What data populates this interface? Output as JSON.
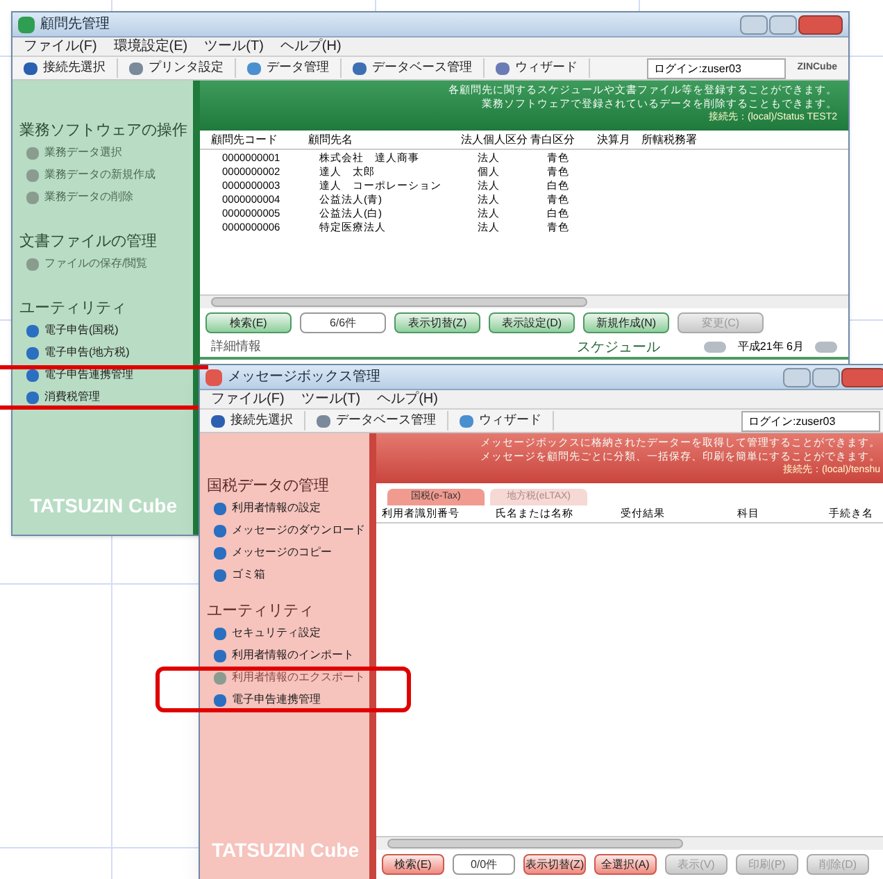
{
  "back_window": {
    "title": "顧問先管理",
    "menu": [
      "ファイル(F)",
      "環境設定(E)",
      "ツール(T)",
      "ヘルプ(H)"
    ],
    "toolbar": [
      "接続先選択",
      "プリンタ設定",
      "データ管理",
      "データベース管理",
      "ウィザード"
    ],
    "login": "ログイン:zuser03",
    "logo_small": "ZINCube",
    "banner": [
      "各顧問先に関するスケジュールや文書ファイル等を登録することができます。",
      "業務ソフトウェアで登録されているデータを削除することもできます。"
    ],
    "connection": "接続先：(local)/Status TEST2",
    "sidebar": [
      {
        "heading": "業務ソフトウェアの操作",
        "items": [
          {
            "label": "業務データ選択",
            "disabled": true
          },
          {
            "label": "業務データの新規作成",
            "disabled": true
          },
          {
            "label": "業務データの削除",
            "disabled": true
          }
        ]
      },
      {
        "heading": "文書ファイルの管理",
        "items": [
          {
            "label": "ファイルの保存/閲覧",
            "disabled": true
          }
        ]
      },
      {
        "heading": "ユーティリティ",
        "items": [
          {
            "label": "電子申告(国税)",
            "disabled": false
          },
          {
            "label": "電子申告(地方税)",
            "disabled": false
          },
          {
            "label": "電子申告連携管理",
            "disabled": false
          },
          {
            "label": "消費税管理",
            "disabled": false
          }
        ]
      }
    ],
    "logo": "TATSUZIN Cube",
    "table": {
      "columns": [
        "顧問先コード",
        "顧問先名",
        "法人個人区分",
        "青白区分",
        "決算月",
        "所轄税務署"
      ],
      "rows": [
        [
          "0000000001",
          "株式会社　達人商事",
          "法人",
          "青色"
        ],
        [
          "0000000002",
          "達人　太郎",
          "個人",
          "青色"
        ],
        [
          "0000000003",
          "達人　コーポレーション",
          "法人",
          "白色"
        ],
        [
          "0000000004",
          "公益法人(青)",
          "法人",
          "青色"
        ],
        [
          "0000000005",
          "公益法人(白)",
          "法人",
          "白色"
        ],
        [
          "0000000006",
          "特定医療法人",
          "法人",
          "青色"
        ]
      ]
    },
    "buttons": [
      {
        "label": "検索(E)",
        "kind": "button",
        "disabled": false
      },
      {
        "label": "6/6件",
        "kind": "counter",
        "disabled": false
      },
      {
        "label": "表示切替(Z)",
        "kind": "button",
        "disabled": false
      },
      {
        "label": "表示設定(D)",
        "kind": "button",
        "disabled": false
      },
      {
        "label": "新規作成(N)",
        "kind": "button",
        "disabled": false
      },
      {
        "label": "変更(C)",
        "kind": "button",
        "disabled": true
      }
    ],
    "detail": {
      "title": "詳細情報",
      "schedule": "スケジュール",
      "month": "平成21年 6月"
    }
  },
  "front_window": {
    "title": "メッセージボックス管理",
    "menu": [
      "ファイル(F)",
      "ツール(T)",
      "ヘルプ(H)"
    ],
    "toolbar": [
      "接続先選択",
      "データベース管理",
      "ウィザード"
    ],
    "login": "ログイン:zuser03",
    "banner": [
      "メッセージボックスに格納されたデーターを取得して管理することができます。",
      "メッセージを顧問先ごとに分類、一括保存、印刷を簡単にすることができます。"
    ],
    "connection": "接続先：(local)/tenshu",
    "tabs": [
      {
        "label": "国税(e-Tax)",
        "selected": true
      },
      {
        "label": "地方税(eLTAX)",
        "selected": false
      }
    ],
    "columns": [
      "利用者識別番号",
      "氏名または名称",
      "受付結果",
      "科目",
      "手続き名"
    ],
    "sidebar": [
      {
        "heading": "国税データの管理",
        "items": [
          {
            "label": "利用者情報の設定",
            "disabled": false
          },
          {
            "label": "メッセージのダウンロード",
            "disabled": false
          },
          {
            "label": "メッセージのコピー",
            "disabled": false
          },
          {
            "label": "ゴミ箱",
            "disabled": false
          }
        ]
      },
      {
        "heading": "ユーティリティ",
        "items": [
          {
            "label": "セキュリティ設定",
            "disabled": false
          },
          {
            "label": "利用者情報のインポート",
            "disabled": false
          },
          {
            "label": "利用者情報のエクスポート",
            "disabled": true
          },
          {
            "label": "電子申告連携管理",
            "disabled": false
          }
        ]
      }
    ],
    "logo": "TATSUZIN Cube",
    "buttons": [
      {
        "label": "検索(E)",
        "kind": "button",
        "disabled": false
      },
      {
        "label": "0/0件",
        "kind": "counter",
        "disabled": false
      },
      {
        "label": "表示切替(Z)",
        "kind": "button",
        "disabled": false
      },
      {
        "label": "全選択(A)",
        "kind": "button",
        "disabled": false
      },
      {
        "label": "表示(V)",
        "kind": "button",
        "disabled": true
      },
      {
        "label": "印刷(P)",
        "kind": "button",
        "disabled": true
      },
      {
        "label": "削除(D)",
        "kind": "button",
        "disabled": true
      }
    ]
  }
}
